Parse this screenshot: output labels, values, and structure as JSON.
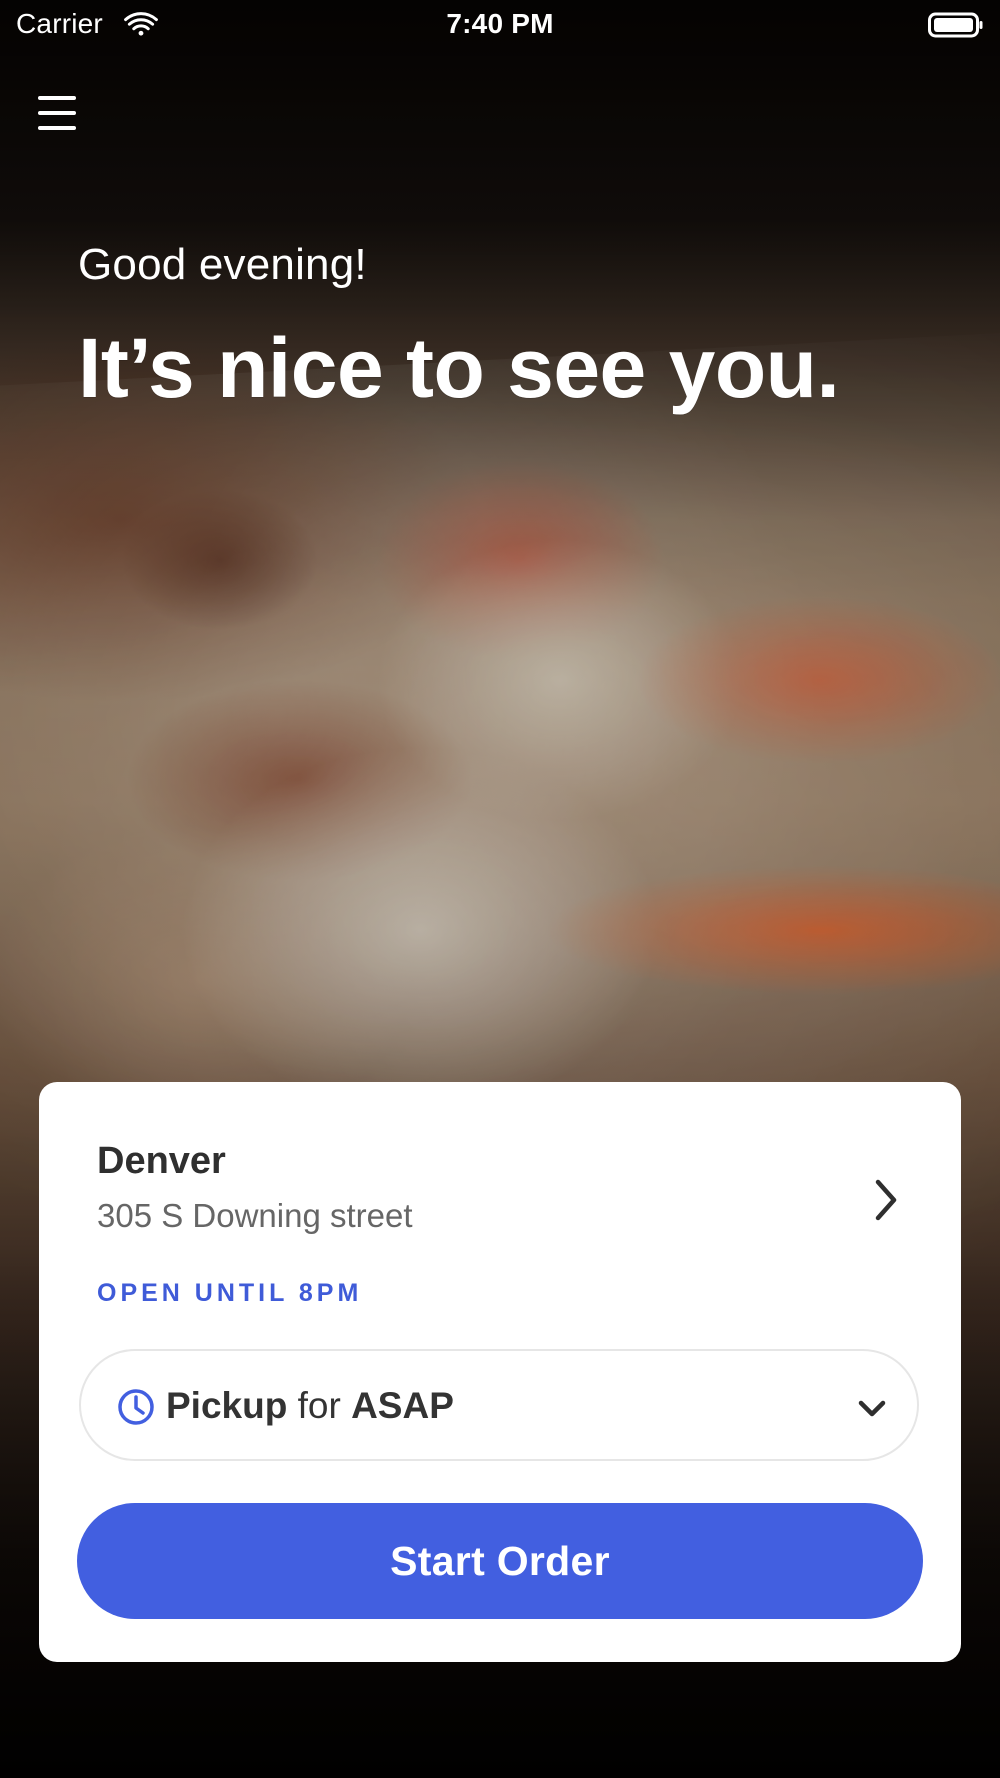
{
  "status_bar": {
    "carrier": "Carrier",
    "time": "7:40 PM",
    "icons": {
      "wifi": "wifi-icon",
      "battery": "battery-icon"
    }
  },
  "hero": {
    "greeting": "Good evening!",
    "headline": "It’s nice to see you."
  },
  "location_card": {
    "city": "Denver",
    "address": "305 S Downing street",
    "hours": "OPEN UNTIL 8PM",
    "pickup": {
      "mode": "Pickup",
      "connector": "for",
      "time": "ASAP"
    },
    "start_order_label": "Start Order"
  },
  "colors": {
    "accent_blue": "#425FE0",
    "card_bg": "#FFFFFF",
    "text_dark": "#2F2F2F",
    "text_muted": "#666666"
  }
}
